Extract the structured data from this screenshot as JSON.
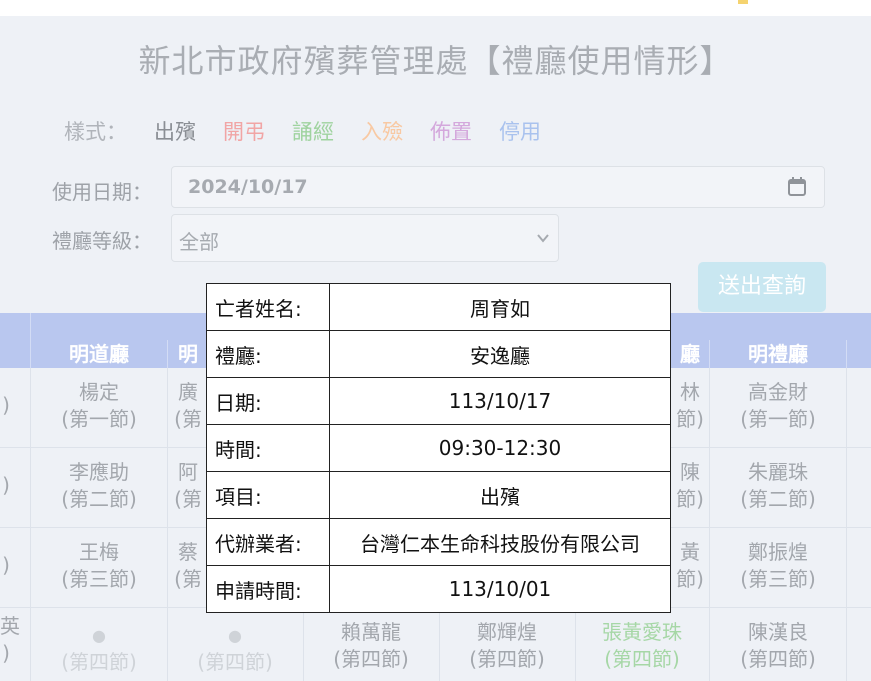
{
  "title": "新北市政府殯葬管理處【禮廳使用情形】",
  "legend": {
    "label": "樣式：",
    "items": [
      {
        "label": "出殯",
        "color": "#8a8e94"
      },
      {
        "label": "開弔",
        "color": "#f1a5a5"
      },
      {
        "label": "誦經",
        "color": "#9fd39f"
      },
      {
        "label": "入殮",
        "color": "#f8c9a3"
      },
      {
        "label": "佈置",
        "color": "#d4a8dc"
      },
      {
        "label": "停用",
        "color": "#a9c2ee"
      }
    ]
  },
  "form": {
    "date_label": "使用日期：",
    "date_value": "2024/10/17",
    "level_label": "禮廳等級：",
    "level_value": "全部",
    "submit_label": "送出查詢"
  },
  "table": {
    "headers": [
      "明道廳",
      "明",
      "廳",
      "明禮廳"
    ],
    "col1": [
      "楊定",
      "(第一節)",
      "李應助",
      "(第二節)",
      "王梅",
      "(第三節)"
    ],
    "col2_partial": [
      "廣",
      "(第",
      "阿",
      "(第",
      "蔡",
      "(第"
    ],
    "col5_partial": [
      "林",
      "節)",
      "陳",
      "節)",
      "黃",
      "節)"
    ],
    "col6": [
      "高金財",
      "(第一節)",
      "朱麗珠",
      "(第二節)",
      "鄭振煌",
      "(第三節)"
    ],
    "left_edge": [
      ")",
      ")",
      ")",
      "英",
      ")"
    ],
    "row4": [
      {
        "name": "●",
        "slot": "(第四節)"
      },
      {
        "name": "●",
        "slot": "(第四節)"
      },
      {
        "name": "賴萬龍",
        "slot": "(第四節)"
      },
      {
        "name": "鄭輝煌",
        "slot": "(第四節)"
      },
      {
        "name": "張黃愛珠",
        "slot": "(第四節)"
      },
      {
        "name": "陳漢良",
        "slot": "(第四節)"
      }
    ]
  },
  "popup": {
    "rows": [
      {
        "key": "亡者姓名:",
        "value": "周育如"
      },
      {
        "key": "禮廳:",
        "value": "安逸廳"
      },
      {
        "key": "日期:",
        "value": "113/10/17"
      },
      {
        "key": "時間:",
        "value": "09:30-12:30"
      },
      {
        "key": "項目:",
        "value": "出殯"
      },
      {
        "key": "代辦業者:",
        "value": "台灣仁本生命科技股份有限公司"
      },
      {
        "key": "申請時間:",
        "value": "113/10/01"
      }
    ]
  }
}
